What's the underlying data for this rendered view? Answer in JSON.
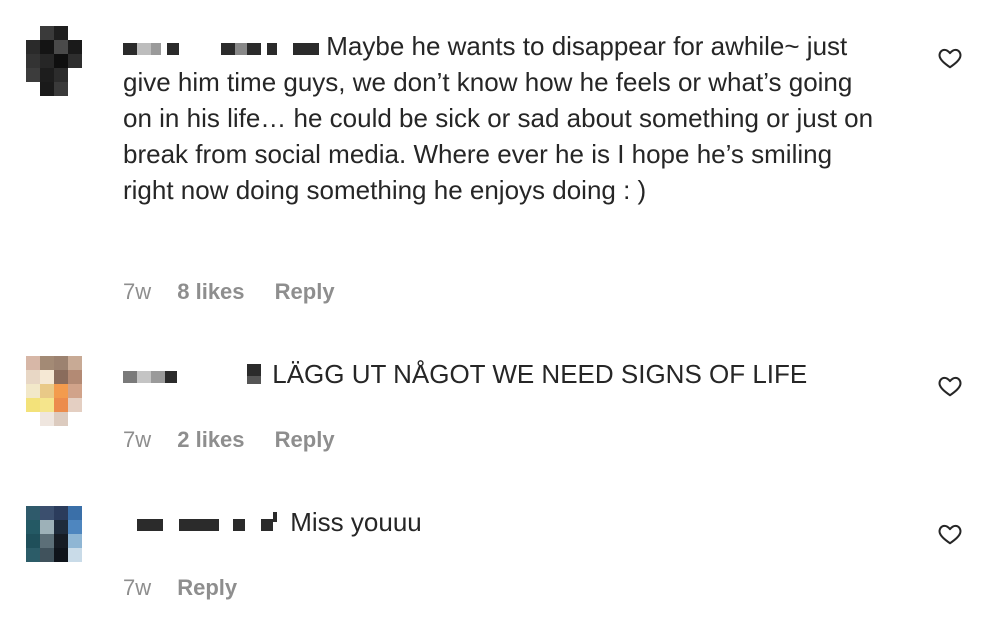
{
  "comments": [
    {
      "text": "Maybe he wants to disappear for awhile~ just give him time guys, we don’t know how he feels or what’s going on in his life… he could be sick or sad about something or just on break from social media. Where ever he is I hope he’s smiling right now doing something he enjoys doing : )",
      "time": "7w",
      "likes": "8 likes",
      "reply": "Reply"
    },
    {
      "text": "LÄGG UT NÅGOT WE NEED SIGNS OF LIFE",
      "time": "7w",
      "likes": "2 likes",
      "reply": "Reply"
    },
    {
      "text": "Miss youuu",
      "time": "7w",
      "reply": "Reply"
    }
  ],
  "icons": {
    "like": "heart-outline-icon"
  },
  "colors": {
    "text": "#262626",
    "secondary": "#8e8e8e"
  }
}
